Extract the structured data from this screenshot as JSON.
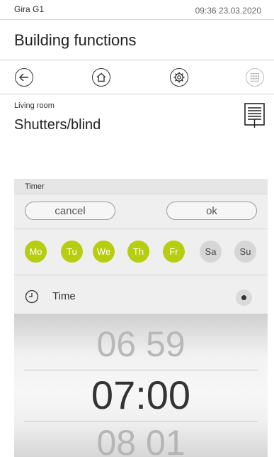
{
  "status": {
    "device": "Gira G1",
    "datetime": "09:36 23.03.2020"
  },
  "header": {
    "title": "Building functions"
  },
  "room": {
    "name": "Living room",
    "function": "Shutters/blind"
  },
  "timer": {
    "title": "Timer",
    "cancel_label": "cancel",
    "ok_label": "ok",
    "days": [
      {
        "label": "Mo",
        "active": true
      },
      {
        "label": "Tu",
        "active": true
      },
      {
        "label": "We",
        "active": true
      },
      {
        "label": "Th",
        "active": true
      },
      {
        "label": "Fr",
        "active": true
      },
      {
        "label": "Sa",
        "active": false
      },
      {
        "label": "Su",
        "active": false
      }
    ],
    "time_label": "Time",
    "time_selected": true,
    "wheel": {
      "prev": "06 59",
      "current": "07:00",
      "next": "08 01"
    }
  },
  "colors": {
    "accent": "#b7cd10",
    "day_off": "#d6d6d6"
  },
  "icons": [
    "back-arrow-icon",
    "home-icon",
    "settings-gear-icon",
    "grid-icon",
    "blind-icon",
    "clock-icon"
  ]
}
